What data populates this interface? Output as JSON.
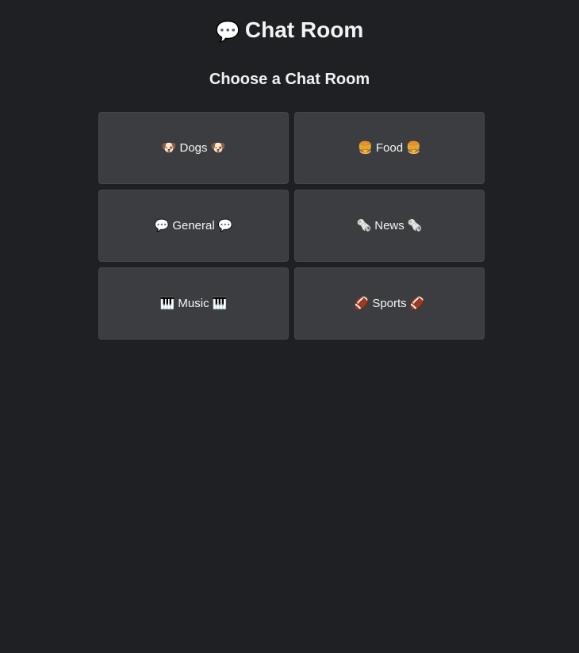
{
  "header": {
    "title_icon": "💬",
    "title": "Chat Room"
  },
  "main": {
    "heading": "Choose a Chat Room",
    "rooms": [
      {
        "label": "Dogs",
        "icon": "🐶",
        "icon_name": "dog-icon"
      },
      {
        "label": "Food",
        "icon": "🍔",
        "icon_name": "burger-icon"
      },
      {
        "label": "General",
        "icon": "💬",
        "icon_name": "speech-bubble-icon"
      },
      {
        "label": "News",
        "icon": "🗞️",
        "icon_name": "newspaper-icon"
      },
      {
        "label": "Music",
        "icon": "🎹",
        "icon_name": "piano-keys-icon"
      },
      {
        "label": "Sports",
        "icon": "🏈",
        "icon_name": "football-icon"
      }
    ]
  },
  "theme": {
    "background": "#1f2023",
    "card_background": "#3c3d40",
    "text": "#f2f2f3"
  }
}
